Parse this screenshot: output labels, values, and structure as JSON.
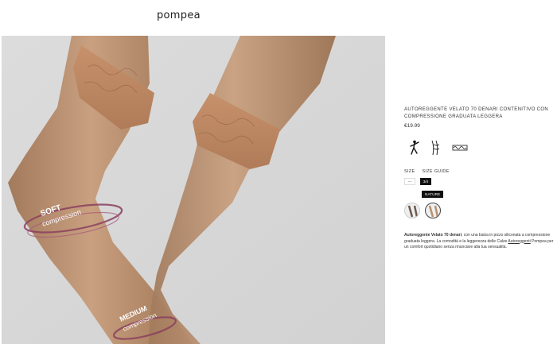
{
  "header": {
    "logo": "pompea"
  },
  "hero": {
    "soft_line1": "SOFT",
    "soft_line2": "compression",
    "medium_line1": "MEDIUM",
    "medium_line2": "compression"
  },
  "product": {
    "title": "AUTOREGGENTE VELATO 70 DENARI CONTENITIVO CON COMPRESSIONE GRADUATA LEGGERA",
    "price": "€19.99",
    "feature_icons": [
      "dancer-icon",
      "legs-icon",
      "lace-band-icon"
    ],
    "size_label": "SIZE",
    "size_guide_label": "SIZE GUIDE",
    "sizes": [
      "—",
      "3/4"
    ],
    "selected_size": "3/4",
    "color_badge": "NATURE",
    "swatches": [
      "nero",
      "nature"
    ],
    "selected_swatch": "nature",
    "desc_bold": "Autoreggente Velato 70 denari",
    "desc_text1": ", con una balza in pizzo siliconata a compressione graduata leggera. La comodità e la leggerezza delle Calze",
    "desc_link": "Autoreggenti",
    "desc_text2": " Pompea per un comfort quotidiano senza rinunciare alla tua sensualità."
  }
}
